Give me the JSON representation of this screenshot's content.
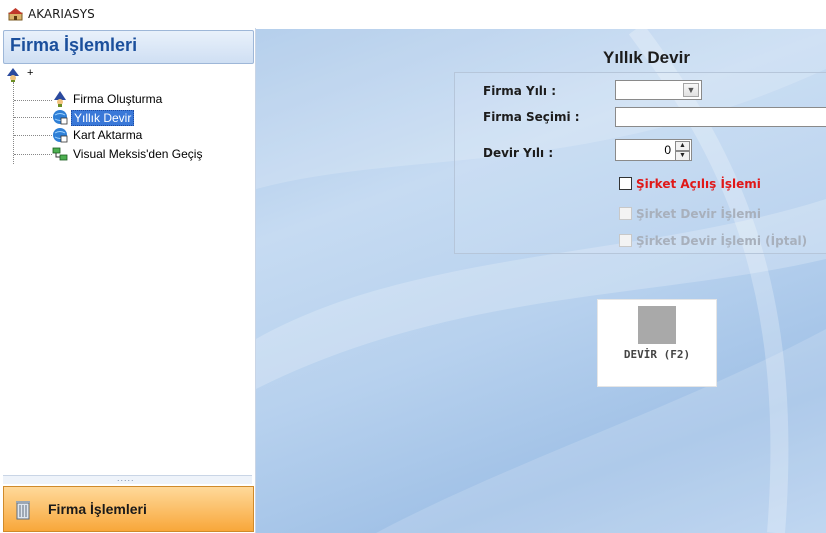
{
  "window": {
    "title": "AKARIASYS",
    "icon": "app-icon"
  },
  "left_panel": {
    "header": "Firma İşlemleri",
    "tree": {
      "root": {
        "toggle": "+",
        "icon": "wizard-icon"
      },
      "items": [
        {
          "label": "Firma Oluşturma",
          "icon": "wizard-icon",
          "selected": false
        },
        {
          "label": "Yıllık Devir",
          "icon": "globe-transfer-icon",
          "selected": true
        },
        {
          "label": "Kart Aktarma",
          "icon": "globe-transfer-icon",
          "selected": false
        },
        {
          "label": "Visual Meksis'den Geçiş",
          "icon": "network-icon",
          "selected": false
        }
      ]
    },
    "splitter_grip": ".....",
    "bottom_tab": {
      "label": "Firma İşlemleri",
      "icon": "trash-bin-icon"
    }
  },
  "main": {
    "title": "Yıllık Devir",
    "form": {
      "firma_yili": {
        "label": "Firma Yılı :",
        "value": ""
      },
      "firma_secimi": {
        "label": "Firma Seçimi :",
        "value": ""
      },
      "devir_yili": {
        "label": "Devir Yılı :",
        "value": "0"
      }
    },
    "checkboxes": [
      {
        "label": "Şirket Açılış İşlemi",
        "checked": false,
        "enabled": true,
        "color": "#e01818"
      },
      {
        "label": "Şirket Devir İşlemi",
        "checked": false,
        "enabled": false
      },
      {
        "label": "Şirket Devir İşlemi (İptal)",
        "checked": false,
        "enabled": false
      }
    ],
    "action_button": {
      "label": "DEVİR (F2)"
    }
  },
  "colors": {
    "header_text": "#1b4f9c",
    "selection": "#3a78d8",
    "tab_orange": "#f8a73a"
  }
}
